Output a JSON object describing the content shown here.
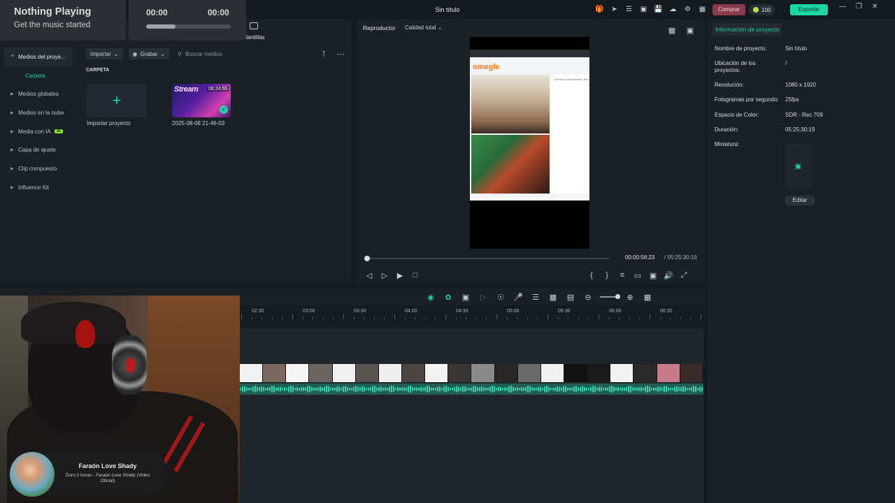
{
  "window": {
    "title": "Sin título",
    "buy_label": "Comprar",
    "credits": "100",
    "export_label": "Exportar",
    "top_icons": [
      "gift-icon",
      "send-icon",
      "list-icon",
      "window-icon",
      "save-icon",
      "cloud-icon",
      "support-icon",
      "layout-icon"
    ],
    "controls": [
      "minimize-icon",
      "restore-icon",
      "close-icon"
    ]
  },
  "now_playing": {
    "title": "Nothing Playing",
    "subtitle": "Get the music started",
    "time_elapsed": "00:00",
    "time_total": "00:00",
    "progress": 0.35
  },
  "tabs": {
    "templates_partial": "lantillas"
  },
  "media": {
    "sidebar": [
      {
        "label": "Medios del proye...",
        "active": true
      },
      {
        "label": "Carpeta",
        "sub": true
      },
      {
        "label": "Medios globales"
      },
      {
        "label": "Medios en la nube"
      },
      {
        "label": "Media con IA",
        "badge": "AI"
      },
      {
        "label": "Capa de ajuste"
      },
      {
        "label": "Clip compuesto"
      },
      {
        "label": "Influence Kit"
      }
    ],
    "import_label": "Importar",
    "record_label": "Grabar",
    "search_placeholder": "Buscar medios",
    "folder_label": "CARPETA",
    "import_project_label": "Importar proyecto",
    "clip": {
      "name": "2025-08-08 21-46-03",
      "duration": "06:24:55",
      "thumb_text": "Stream"
    }
  },
  "player": {
    "tab_label": "Reproductor",
    "quality_label": "Calidad total",
    "current_time": "00:00:56:23",
    "total_time": "/  05:25:30:19",
    "progress": 0.01,
    "preview": {
      "site_logo": "omegle",
      "chat_text": "Conoce a otra persona. Ahr..."
    }
  },
  "project_info": {
    "tab_label": "Información de proyecto",
    "fields": [
      {
        "key": "Nombre de proyecto:",
        "value": "Sin título"
      },
      {
        "key": "Ubicación de los proyectos:",
        "value": "/"
      },
      {
        "key": "Resolución:",
        "value": "1080 x 1920"
      },
      {
        "key": "Fotogramas por segundo:",
        "value": "25fps"
      },
      {
        "key": "Espacio de Color:",
        "value": "SDR - Rec.709"
      },
      {
        "key": "Duración:",
        "value": "05:25:30:19"
      },
      {
        "key": "Miniatura:",
        "value": ""
      }
    ],
    "edit_label": "Editar"
  },
  "timeline": {
    "ruler_labels": [
      "02:30",
      "03:00",
      "03:30",
      "04:00",
      "04:30",
      "05:00",
      "05:30",
      "06:00",
      "06:30"
    ],
    "segment_colors": [
      "#f2f2f2",
      "#7a6a60",
      "#f5f5f5",
      "#6a6560",
      "#f0f0f0",
      "#5a5450",
      "#efefef",
      "#4a4541",
      "#f3f3f3",
      "#3a3633",
      "#8a8a8a",
      "#2a2826",
      "#6a6a6a",
      "#f0f0f0",
      "#111111",
      "#1a1a1a",
      "#f2f2f2",
      "#2a2a2a",
      "#c97a8a",
      "#3a2a2a"
    ]
  },
  "song": {
    "artist": "Faraón Love Shady",
    "title": "Duro 2 horas - Faraón Love Shady (Video Oficial)"
  }
}
